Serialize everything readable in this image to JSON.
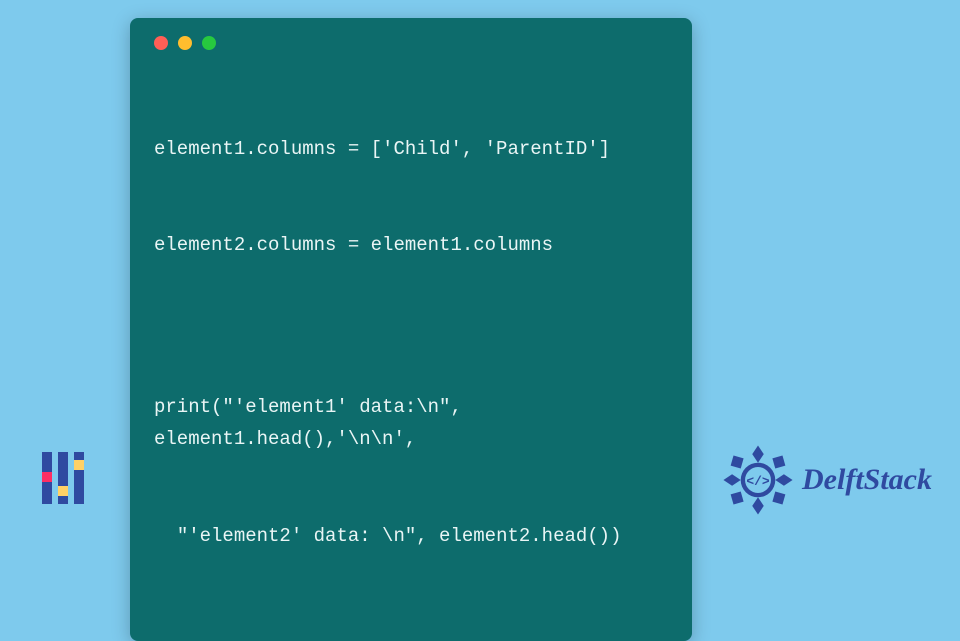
{
  "window": {
    "dots": [
      "red",
      "yellow",
      "green"
    ]
  },
  "code": {
    "line1": "element1.columns = ['Child', 'ParentID']",
    "line2": "element2.columns = element1.columns",
    "line3": "",
    "line4": "print(\"'element1' data:\\n\", element1.head(),'\\n\\n',",
    "line5": "  \"'element2' data: \\n\", element2.head())"
  },
  "brand": {
    "name": "DelftStack"
  },
  "colors": {
    "page_bg": "#7ecaed",
    "window_bg": "#0d6c6c",
    "accent_blue": "#2f4aa0"
  }
}
